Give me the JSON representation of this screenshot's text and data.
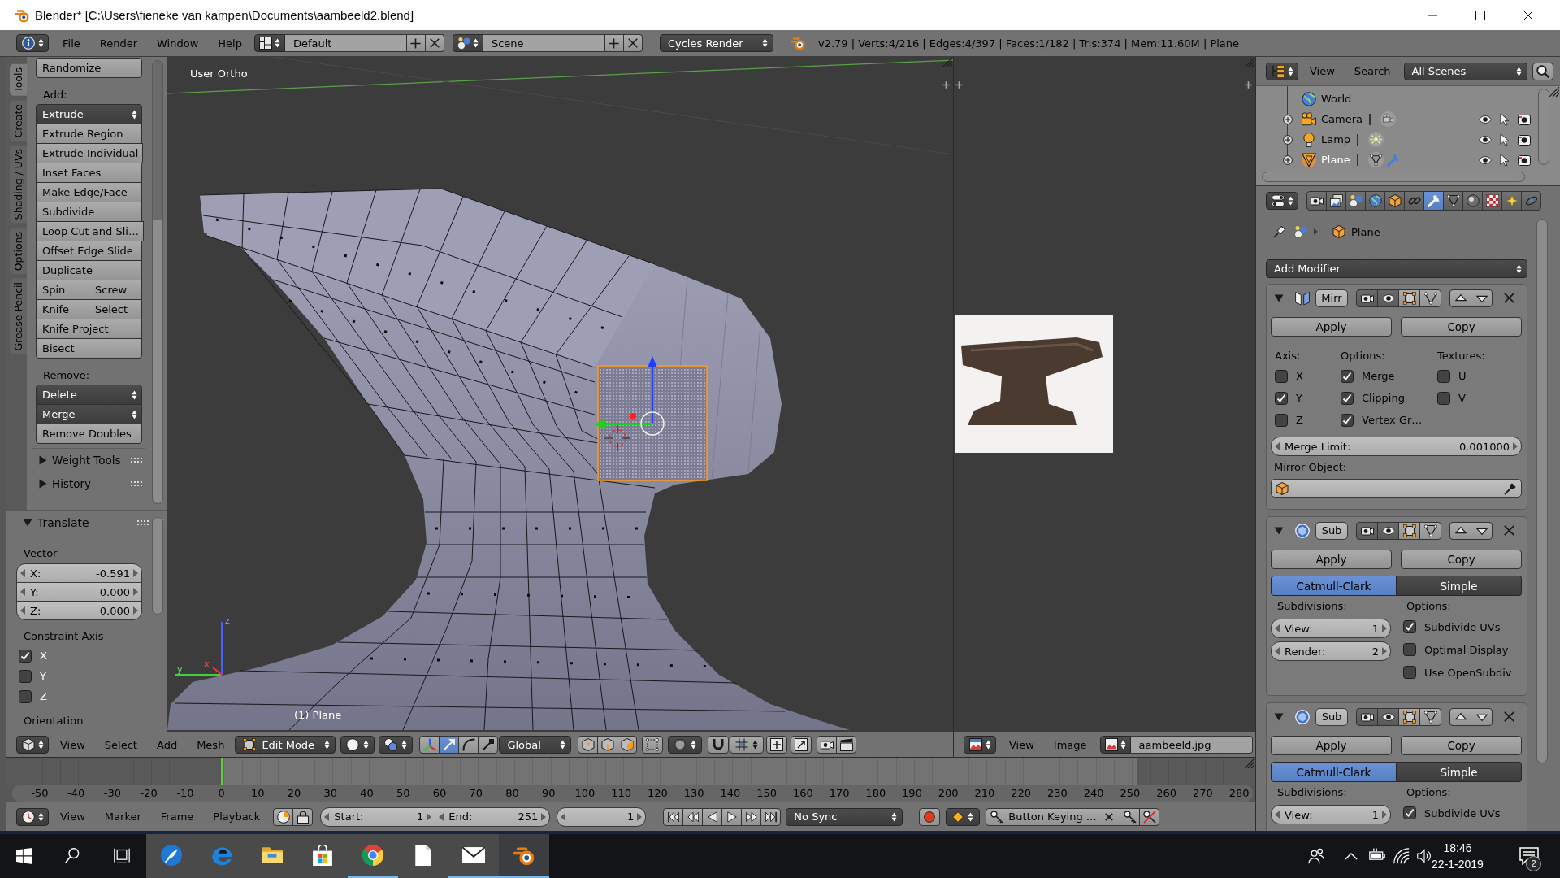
{
  "window": {
    "title": "Blender* [C:\\Users\\fieneke van kampen\\Documents\\aambeeld2.blend]"
  },
  "info_header": {
    "menus": [
      "File",
      "Render",
      "Window",
      "Help"
    ],
    "screen_layout": "Default",
    "scene": "Scene",
    "render_engine": "Cycles Render",
    "stats": "v2.79 | Verts:4/216 | Edges:4/397 | Faces:1/182 | Tris:374 | Mem:11.60M | Plane"
  },
  "tool_shelf": {
    "tabs": [
      {
        "label": "Tools",
        "selected": true
      },
      {
        "label": "Create",
        "selected": false
      },
      {
        "label": "Shading / UVs",
        "selected": false
      },
      {
        "label": "Options",
        "selected": false
      },
      {
        "label": "Grease Pencil",
        "selected": false
      }
    ],
    "blocks": [
      {
        "buttons": [
          {
            "kind": "button",
            "labels": [
              "Randomize"
            ]
          }
        ]
      },
      {
        "heading": "Add:",
        "buttons": [
          {
            "kind": "menu",
            "labels": [
              "Extrude"
            ]
          },
          {
            "kind": "button",
            "labels": [
              "Extrude Region"
            ]
          },
          {
            "kind": "button",
            "labels": [
              "Extrude Individual"
            ]
          },
          {
            "kind": "button",
            "labels": [
              "Inset Faces"
            ]
          },
          {
            "kind": "button",
            "labels": [
              "Make Edge/Face"
            ]
          },
          {
            "kind": "button",
            "labels": [
              "Subdivide"
            ]
          },
          {
            "kind": "button",
            "labels": [
              "Loop Cut and Sli…"
            ]
          },
          {
            "kind": "button",
            "labels": [
              "Offset Edge Slide"
            ]
          },
          {
            "kind": "button",
            "labels": [
              "Duplicate"
            ]
          },
          {
            "kind": "button",
            "labels": [
              "Spin",
              "Screw"
            ]
          },
          {
            "kind": "button",
            "labels": [
              "Knife",
              "Select"
            ]
          },
          {
            "kind": "button",
            "labels": [
              "Knife Project"
            ]
          },
          {
            "kind": "button",
            "labels": [
              "Bisect"
            ]
          }
        ]
      },
      {
        "heading": "Remove:",
        "buttons": [
          {
            "kind": "menu",
            "labels": [
              "Delete"
            ]
          },
          {
            "kind": "menu",
            "labels": [
              "Merge"
            ]
          },
          {
            "kind": "button",
            "labels": [
              "Remove Doubles"
            ]
          }
        ]
      }
    ],
    "panels": [
      {
        "title": "Weight Tools",
        "expanded": false
      },
      {
        "title": "History",
        "expanded": false
      }
    ]
  },
  "operator_panel": {
    "title": "Translate",
    "expanded": true,
    "vector_label": "Vector",
    "vector": [
      {
        "label": "X:",
        "value": "-0.591"
      },
      {
        "label": "Y:",
        "value": "0.000"
      },
      {
        "label": "Z:",
        "value": "0.000"
      }
    ],
    "constraint_label": "Constraint Axis",
    "constraint_axes": [
      {
        "label": "X",
        "checked": true
      },
      {
        "label": "Y",
        "checked": false
      },
      {
        "label": "Z",
        "checked": false
      }
    ],
    "orientation_label": "Orientation"
  },
  "viewport": {
    "view_name": "User Ortho",
    "object_info": "(1) Plane",
    "axis_labels": [
      "z",
      "y",
      "x"
    ]
  },
  "viewport_header": {
    "menus": [
      "View",
      "Select",
      "Add",
      "Mesh"
    ],
    "mode": "Edit Mode",
    "manipulators": [
      {
        "selected": true
      },
      {
        "selected": false
      },
      {
        "selected": false
      }
    ],
    "orientation": "Global"
  },
  "image_editor": {
    "menus": [
      "View",
      "Image"
    ],
    "image_name": "aambeeld.jpg"
  },
  "timeline": {
    "ruler": [
      "-50",
      "-40",
      "-30",
      "-20",
      "-10",
      "0",
      "10",
      "20",
      "30",
      "40",
      "50",
      "60",
      "70",
      "80",
      "90",
      "100",
      "110",
      "120",
      "130",
      "140",
      "150",
      "160",
      "170",
      "180",
      "190",
      "200",
      "210",
      "220",
      "230",
      "240",
      "250",
      "260",
      "270",
      "280"
    ],
    "menus": [
      "View",
      "Marker",
      "Frame",
      "Playback"
    ],
    "start": {
      "label": "Start:",
      "value": "1"
    },
    "end": {
      "label": "End:",
      "value": "251"
    },
    "current_frame": "1",
    "sync": "No Sync",
    "keying_set": "Button Keying …"
  },
  "outliner": {
    "menus": [
      "View",
      "Search"
    ],
    "display_mode": "All Scenes",
    "items": [
      {
        "kind": "world",
        "label": "World",
        "selected": false
      },
      {
        "kind": "camera",
        "label": "Camera",
        "selected": false
      },
      {
        "kind": "lamp",
        "label": "Lamp",
        "selected": false
      },
      {
        "kind": "mesh",
        "label": "Plane",
        "selected": true
      }
    ]
  },
  "properties": {
    "tabs": [
      {
        "kind": "render",
        "selected": false
      },
      {
        "kind": "render_layers",
        "selected": false
      },
      {
        "kind": "scene",
        "selected": false
      },
      {
        "kind": "world",
        "selected": false
      },
      {
        "kind": "object",
        "selected": false
      },
      {
        "kind": "constraints",
        "selected": false
      },
      {
        "kind": "modifiers",
        "selected": true
      },
      {
        "kind": "data",
        "selected": false
      },
      {
        "kind": "material",
        "selected": false
      },
      {
        "kind": "texture",
        "selected": false
      },
      {
        "kind": "particles",
        "selected": false
      },
      {
        "kind": "physics",
        "selected": false
      }
    ],
    "context": "Plane",
    "add_modifier": "Add Modifier",
    "modifiers": [
      {
        "kind": "mirror",
        "name": "Mirr",
        "expanded": true,
        "apply": "Apply",
        "copy": "Copy",
        "axis_label": "Axis:",
        "options_label": "Options:",
        "textures_label": "Textures:",
        "axes": [
          {
            "label": "X",
            "checked": false
          },
          {
            "label": "Y",
            "checked": true
          },
          {
            "label": "Z",
            "checked": false
          }
        ],
        "options": [
          {
            "label": "Merge",
            "checked": true
          },
          {
            "label": "Clipping",
            "checked": true
          },
          {
            "label": "Vertex Gr…",
            "checked": true
          }
        ],
        "textures": [
          {
            "label": "U",
            "checked": false
          },
          {
            "label": "V",
            "checked": false
          }
        ],
        "merge_limit": {
          "label": "Merge Limit:",
          "value": "0.001000"
        },
        "mirror_object_label": "Mirror Object:"
      },
      {
        "kind": "subsurf",
        "name": "Sub",
        "expanded": true,
        "apply": "Apply",
        "copy": "Copy",
        "types": [
          {
            "label": "Catmull-Clark",
            "selected": true
          },
          {
            "label": "Simple",
            "selected": false
          }
        ],
        "subdivisions_label": "Subdivisions:",
        "levels": [
          {
            "label": "View:",
            "value": "1"
          },
          {
            "label": "Render:",
            "value": "2"
          }
        ],
        "options_label": "Options:",
        "options": [
          {
            "label": "Subdivide UVs",
            "checked": true
          },
          {
            "label": "Optimal Display",
            "checked": false
          },
          {
            "label": "Use OpenSubdiv",
            "checked": false
          }
        ]
      },
      {
        "kind": "subsurf",
        "name": "Sub",
        "expanded": true,
        "apply": "Apply",
        "copy": "Copy",
        "types": [
          {
            "label": "Catmull-Clark",
            "selected": true
          },
          {
            "label": "Simple",
            "selected": false
          }
        ],
        "subdivisions_label": "Subdivisions:",
        "levels": [
          {
            "label": "View:",
            "value": "1"
          }
        ],
        "options_label": "Options:",
        "options": [
          {
            "label": "Subdivide UVs",
            "checked": true
          }
        ]
      }
    ]
  },
  "taskbar": {
    "apps": [
      {
        "kind": "ink",
        "running": false,
        "active": false
      },
      {
        "kind": "edge",
        "running": false,
        "active": false
      },
      {
        "kind": "explorer",
        "running": false,
        "active": false
      },
      {
        "kind": "store",
        "running": false,
        "active": false
      },
      {
        "kind": "chrome",
        "running": true,
        "active": false
      },
      {
        "kind": "file",
        "running": false,
        "active": false
      },
      {
        "kind": "mail",
        "running": true,
        "active": false
      },
      {
        "kind": "blender",
        "running": true,
        "active": true
      }
    ],
    "time": "18:46",
    "date": "22-1-2019",
    "notifications": "2"
  }
}
